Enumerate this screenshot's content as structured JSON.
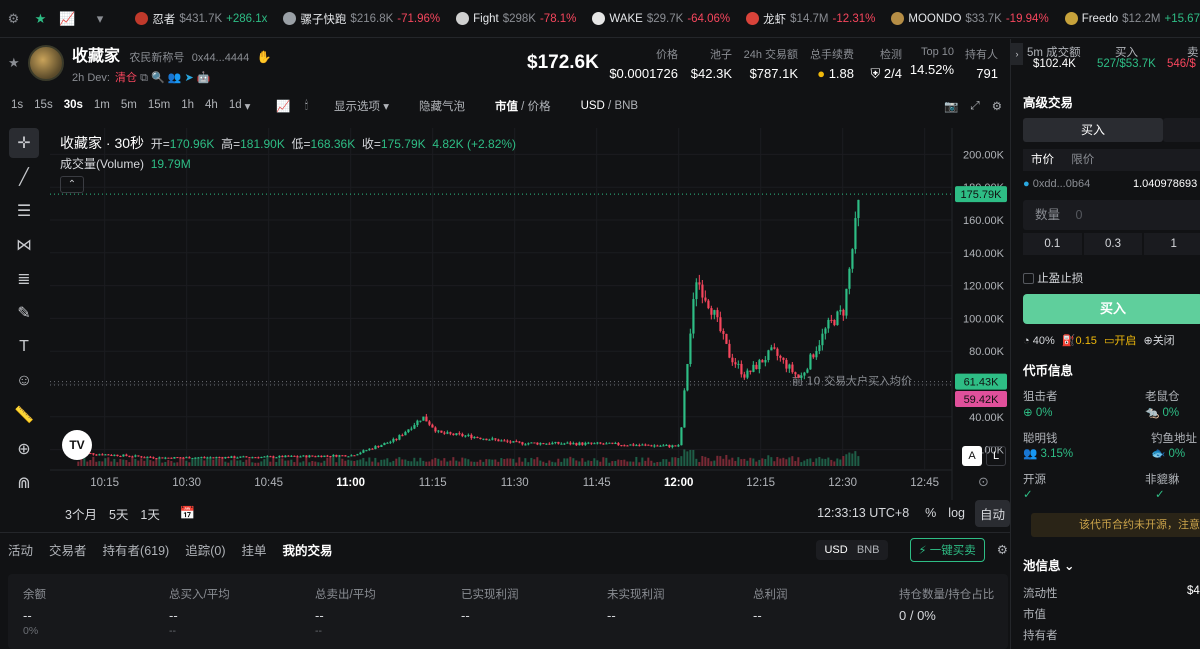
{
  "ticker": [
    {
      "name": "忍者",
      "mc": "$431.7K",
      "chg": "+286.1x",
      "dir": "up",
      "color": "#c0392b"
    },
    {
      "name": "骡子快跑",
      "mc": "$216.8K",
      "chg": "-71.96%",
      "dir": "down",
      "color": "#9aa0a6"
    },
    {
      "name": "Fight",
      "mc": "$298K",
      "chg": "-78.1%",
      "dir": "down",
      "color": "#d0d0d0"
    },
    {
      "name": "WAKE",
      "mc": "$29.7K",
      "chg": "-64.06%",
      "dir": "down",
      "color": "#e6e6e6"
    },
    {
      "name": "龙虾",
      "mc": "$14.7M",
      "chg": "-12.31%",
      "dir": "down",
      "color": "#d9433a"
    },
    {
      "name": "MOONDO",
      "mc": "$33.7K",
      "chg": "-19.94%",
      "dir": "down",
      "color": "#b58d45"
    },
    {
      "name": "Freedo",
      "mc": "$12.2M",
      "chg": "+15.67",
      "dir": "up",
      "color": "#c7a23b"
    }
  ],
  "header": {
    "name": "收藏家",
    "sub": "农民新称号",
    "address": "0x44...4444",
    "age": "2h",
    "dev_label": "Dev:",
    "dev_status": "清仓",
    "price_big": "$172.6K",
    "stats": [
      {
        "label": "价格",
        "value": "$0.0001726"
      },
      {
        "label": "池子",
        "value": "$42.3K"
      },
      {
        "label": "24h 交易额",
        "value": "$787.1K"
      },
      {
        "label": "总手续费",
        "value": "1.88"
      },
      {
        "label": "检测",
        "value": "2/4"
      },
      {
        "label": "Top 10",
        "value": "14.52%"
      },
      {
        "label": "持有人",
        "value": "791"
      }
    ]
  },
  "timeframes": [
    "1s",
    "15s",
    "30s",
    "1m",
    "5m",
    "15m",
    "1h",
    "4h",
    "1d"
  ],
  "active_timeframe": "30s",
  "toolbar": {
    "display_options": "显示选项",
    "hide_bubbles": "隐藏气泡",
    "mc_label": "市值",
    "price_label": "价格",
    "usd": "USD",
    "bnb": "BNB"
  },
  "legend": {
    "title": "收藏家 · 30秒",
    "open_label": "开=",
    "open": "170.96K",
    "high_label": "高=",
    "high": "181.90K",
    "low_label": "低=",
    "low": "168.36K",
    "close_label": "收=",
    "close": "175.79K",
    "change": "4.82K (+2.82%)",
    "volume_label": "成交量(Volume)",
    "volume": "19.79M"
  },
  "chart_data": {
    "type": "candlestick",
    "y_ticks": [
      "200.00K",
      "180.00K",
      "160.00K",
      "140.00K",
      "120.00K",
      "100.00K",
      "80.00K",
      "60.00K",
      "40.00K",
      "20.00K"
    ],
    "y_tick_values": [
      200000,
      180000,
      160000,
      140000,
      120000,
      100000,
      80000,
      60000,
      40000,
      20000
    ],
    "x_ticks": [
      "10:15",
      "10:30",
      "10:45",
      "11:00",
      "11:15",
      "11:30",
      "11:45",
      "12:00",
      "12:15",
      "12:30",
      "12:45"
    ],
    "bold_x_ticks": [
      "11:00",
      "12:00"
    ],
    "ylim": [
      10000,
      210000
    ],
    "last_price": "175.79K",
    "last_price_value": 175790,
    "ref_green": "61.43K",
    "ref_green_value": 61430,
    "ref_red": "59.42K",
    "ref_red_value": 59420,
    "annotation": "前 10 交易大户买入均价",
    "path": [
      {
        "t": "10:10",
        "v": 18000
      },
      {
        "t": "10:25",
        "v": 15000
      },
      {
        "t": "10:45",
        "v": 15500
      },
      {
        "t": "11:00",
        "v": 16500
      },
      {
        "t": "11:08",
        "v": 26000
      },
      {
        "t": "11:13",
        "v": 40000
      },
      {
        "t": "11:16",
        "v": 30000
      },
      {
        "t": "11:22",
        "v": 28000
      },
      {
        "t": "11:30",
        "v": 24000
      },
      {
        "t": "11:45",
        "v": 23500
      },
      {
        "t": "12:00",
        "v": 22000
      },
      {
        "t": "12:01",
        "v": 60000
      },
      {
        "t": "12:03",
        "v": 125000
      },
      {
        "t": "12:06",
        "v": 105000
      },
      {
        "t": "12:09",
        "v": 78000
      },
      {
        "t": "12:12",
        "v": 65000
      },
      {
        "t": "12:17",
        "v": 80000
      },
      {
        "t": "12:22",
        "v": 63000
      },
      {
        "t": "12:27",
        "v": 95000
      },
      {
        "t": "12:30",
        "v": 105000
      },
      {
        "t": "12:33",
        "v": 175790
      }
    ]
  },
  "range": {
    "r1": "3个月",
    "r2": "5天",
    "r3": "1天",
    "time": "12:33:13 UTC+8",
    "pct": "%",
    "log": "log",
    "auto": "自动"
  },
  "bottom_tabs": [
    "活动",
    "交易者",
    "持有者(619)",
    "追踪(0)",
    "挂单",
    "我的交易"
  ],
  "active_bottom_tab": "我的交易",
  "bottom_right": {
    "usd": "USD",
    "bnb": "BNB",
    "quick_buy": "一键买卖"
  },
  "stats_panel": [
    {
      "label": "余额",
      "value": "--",
      "sub": "0%"
    },
    {
      "label": "总买入/平均",
      "value": "--",
      "sub": "--"
    },
    {
      "label": "总卖出/平均",
      "value": "--",
      "sub": "--"
    },
    {
      "label": "已实现利润",
      "value": "--",
      "sub": ""
    },
    {
      "label": "未实现利润",
      "value": "--",
      "sub": ""
    },
    {
      "label": "总利润",
      "value": "--",
      "sub": ""
    },
    {
      "label": "持仓数量/持仓占比",
      "value": "0 / 0%",
      "sub": ""
    }
  ],
  "right": {
    "vol_label": "5m 成交额",
    "vol_value": "$102.4K",
    "buy_label": "买入",
    "buy_value": "527/$53.7K",
    "sell_label": "卖",
    "sell_value": "546/$",
    "adv_trade": "高级交易",
    "buy_tab": "买入",
    "market": "市价",
    "limit": "限价",
    "wallet": "0xdd...0b64",
    "balance": "1.040978693",
    "qty_label": "数量",
    "qty_placeholder": "0",
    "presets": [
      "0.1",
      "0.3",
      "1"
    ],
    "tpsl": "止盈止损",
    "buy_button": "买入",
    "opt1": "40%",
    "opt2": "0.15",
    "opt3": "开启",
    "opt4": "关闭",
    "token_info": "代币信息",
    "info": [
      {
        "label": "狙击者",
        "value": "0%"
      },
      {
        "label": "老鼠仓",
        "value": "0%"
      },
      {
        "label": "聪明钱",
        "value": "3.15%"
      },
      {
        "label": "钓鱼地址",
        "value": "0%"
      },
      {
        "label": "开源",
        "value": "✓"
      },
      {
        "label": "非貔貅",
        "value": "✓"
      }
    ],
    "warning": "该代币合约未开源，注意",
    "pool_info": "池信息",
    "liquidity": "流动性",
    "liquidity_val": "$4",
    "mc": "市值",
    "holders": "持有者"
  }
}
